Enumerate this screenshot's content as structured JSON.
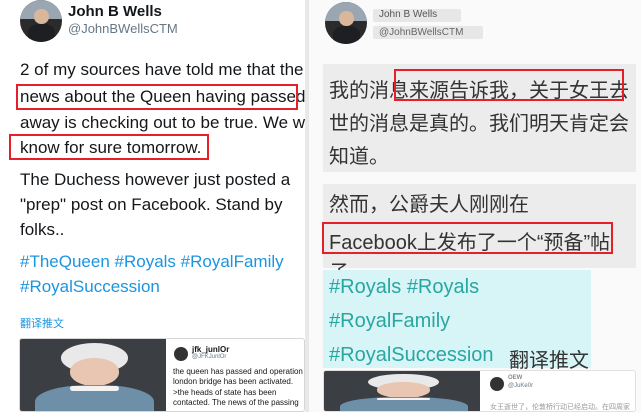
{
  "left": {
    "user": {
      "name": "John B Wells",
      "handle": "@JohnBWellsCTM"
    },
    "tweet_lines": [
      "2 of my sources have told me that the",
      "news about the Queen having passed",
      "away is checking out to be true. We will",
      "know for sure tomorrow.",
      "The Duchess however just posted a",
      "\"prep\" post on Facebook. Stand by",
      "folks.."
    ],
    "hashtag_lines": [
      "#TheQueen #Royals #RoyalFamily",
      "#RoyalSuccession"
    ],
    "translate_label": "翻译推文",
    "embed": {
      "name": "jfk_junlOr",
      "handle": "@JFKJunlOr",
      "text_lines": [
        "the queen has passed and operation",
        "london bridge has been activated.",
        ">the heads of state has been",
        "contacted. The news of the passing"
      ]
    }
  },
  "right": {
    "user": {
      "name": "John B Wells",
      "handle": "@JohnBWellsCTM"
    },
    "tweet_lines": [
      "我的消息来源告诉我，关于女王去",
      "世的消息是真的。我们明天肯定会",
      "知道。",
      "然而，公爵夫人刚刚在",
      "Facebook上发布了一个“预备”帖",
      "子。"
    ],
    "hashtag_lines": [
      "#Royals #Royals",
      "#RoyalFamily",
      "#RoyalSuccession"
    ],
    "translate_label": "翻译推文",
    "embed": {
      "name": "OEW",
      "handle": "@JuKe0r",
      "text": "女王逝世了，伦敦桥行动已经启动。在四周家"
    }
  }
}
